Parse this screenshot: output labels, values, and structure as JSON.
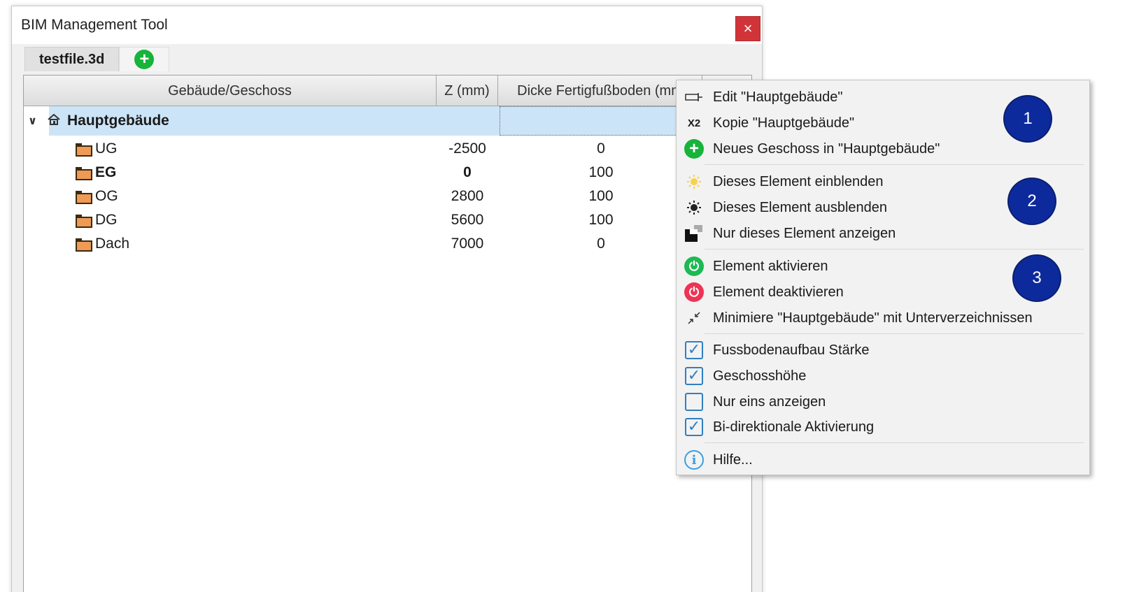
{
  "window": {
    "title": "BIM Management Tool",
    "close_label": "×"
  },
  "tabs": [
    {
      "label": "testfile.3d"
    }
  ],
  "tab_add_symbol": "+",
  "columns": [
    "Gebäude/Geschoss",
    "Z (mm)",
    "Dicke Fertigfußboden (mm"
  ],
  "building": {
    "chevron": "∨",
    "icon": "house-icon",
    "name": "Hauptgebäude"
  },
  "floors": [
    {
      "name": "UG",
      "z": "-2500",
      "d": "0",
      "bold": false
    },
    {
      "name": "EG",
      "z": "0",
      "d": "100",
      "bold": true
    },
    {
      "name": "OG",
      "z": "2800",
      "d": "100",
      "bold": false
    },
    {
      "name": "DG",
      "z": "5600",
      "d": "100",
      "bold": false
    },
    {
      "name": "Dach",
      "z": "7000",
      "d": "0",
      "bold": false
    }
  ],
  "context_menu": {
    "items": [
      {
        "label": "Edit \"Hauptgebäude\"",
        "icon": "edit-icon"
      },
      {
        "label": "Kopie \"Hauptgebäude\"",
        "icon": "copy-x2-icon",
        "icon_text": "X2"
      },
      {
        "label": "Neues Geschoss in \"Hauptgebäude\"",
        "icon": "add-icon"
      },
      {
        "label": "Dieses Element einblenden",
        "icon": "show-icon"
      },
      {
        "label": "Dieses Element ausblenden",
        "icon": "hide-icon"
      },
      {
        "label": "Nur dieses Element anzeigen",
        "icon": "isolate-icon"
      },
      {
        "label": "Element aktivieren",
        "icon": "power-on-icon",
        "color": "#1db954"
      },
      {
        "label": "Element deaktivieren",
        "icon": "power-off-icon",
        "color": "#ee3355"
      },
      {
        "label": "Minimiere \"Hauptgebäude\" mit Unterverzeichnissen",
        "icon": "collapse-icon"
      },
      {
        "label": "Fussbodenaufbau Stärke",
        "icon": "checkbox-icon",
        "checked": true
      },
      {
        "label": "Geschosshöhe",
        "icon": "checkbox-icon",
        "checked": true
      },
      {
        "label": "Nur eins anzeigen",
        "icon": "checkbox-icon",
        "checked": false
      },
      {
        "label": "Bi-direktionale Aktivierung",
        "icon": "checkbox-icon",
        "checked": true
      },
      {
        "label": "Hilfe...",
        "icon": "info-icon"
      }
    ]
  },
  "badges": [
    "1",
    "2",
    "3"
  ],
  "colors": {
    "selection": "#cce4f7",
    "badge": "#0d2a9c",
    "close": "#d13438",
    "add": "#17b33a"
  }
}
